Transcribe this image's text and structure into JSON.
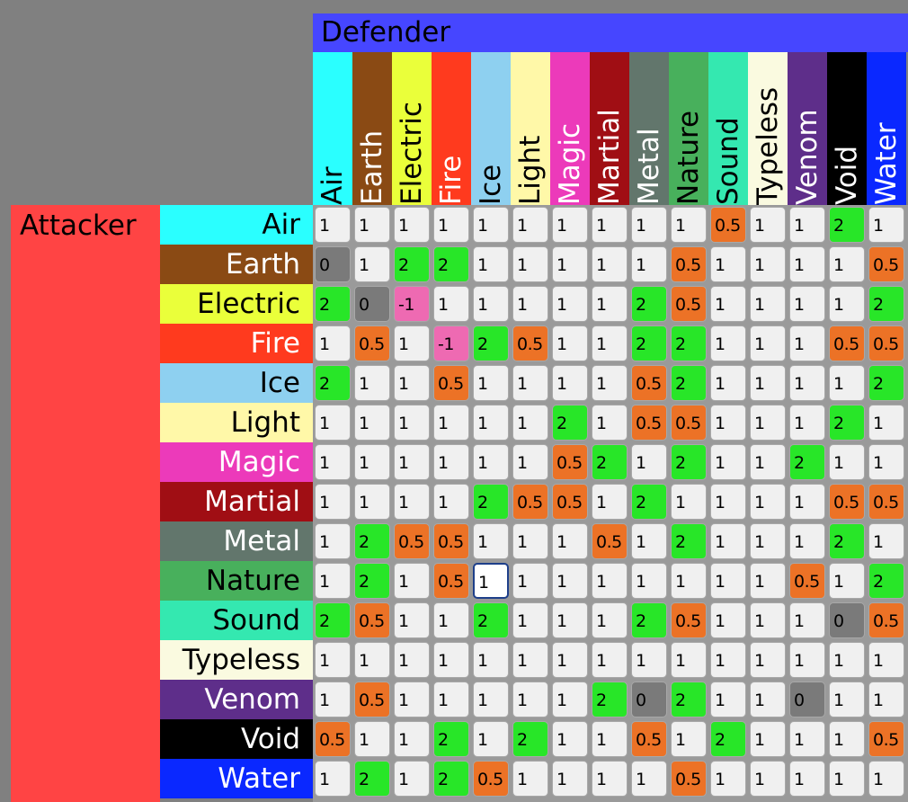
{
  "defender_label": "Defender",
  "attacker_label": "Attacker",
  "types": [
    {
      "name": "Air",
      "bg": "#2affff",
      "fg": "#000000"
    },
    {
      "name": "Earth",
      "bg": "#8a4a14",
      "fg": "#ffffff"
    },
    {
      "name": "Electric",
      "bg": "#eaff3a",
      "fg": "#000000"
    },
    {
      "name": "Fire",
      "bg": "#ff3a1e",
      "fg": "#ffffff"
    },
    {
      "name": "Ice",
      "bg": "#8ed0f0",
      "fg": "#000000"
    },
    {
      "name": "Light",
      "bg": "#fff8a8",
      "fg": "#000000"
    },
    {
      "name": "Magic",
      "bg": "#ec3aba",
      "fg": "#ffffff"
    },
    {
      "name": "Martial",
      "bg": "#a00e14",
      "fg": "#ffffff"
    },
    {
      "name": "Metal",
      "bg": "#62766c",
      "fg": "#ffffff"
    },
    {
      "name": "Nature",
      "bg": "#48b05c",
      "fg": "#000000"
    },
    {
      "name": "Sound",
      "bg": "#34e8b0",
      "fg": "#000000"
    },
    {
      "name": "Typeless",
      "bg": "#fafae0",
      "fg": "#000000"
    },
    {
      "name": "Venom",
      "bg": "#5e2e8a",
      "fg": "#ffffff"
    },
    {
      "name": "Void",
      "bg": "#000000",
      "fg": "#ffffff"
    },
    {
      "name": "Water",
      "bg": "#0a28ff",
      "fg": "#ffffff"
    }
  ],
  "value_colors": {
    "1": "#f0f0f0",
    "2": "#28e628",
    "0.5": "#ec7226",
    "0": "#7a7a7a",
    "-1": "#ee6ab2"
  },
  "selected_cell": {
    "row": 9,
    "col": 4
  },
  "matrix": [
    [
      "1",
      "1",
      "1",
      "1",
      "1",
      "1",
      "1",
      "1",
      "1",
      "1",
      "0.5",
      "1",
      "1",
      "2",
      "1"
    ],
    [
      "0",
      "1",
      "2",
      "2",
      "1",
      "1",
      "1",
      "1",
      "1",
      "0.5",
      "1",
      "1",
      "1",
      "1",
      "0.5"
    ],
    [
      "2",
      "0",
      "-1",
      "1",
      "1",
      "1",
      "1",
      "1",
      "2",
      "0.5",
      "1",
      "1",
      "1",
      "1",
      "2"
    ],
    [
      "1",
      "0.5",
      "1",
      "-1",
      "2",
      "0.5",
      "1",
      "1",
      "2",
      "2",
      "1",
      "1",
      "1",
      "0.5",
      "0.5"
    ],
    [
      "2",
      "1",
      "1",
      "0.5",
      "1",
      "1",
      "1",
      "1",
      "0.5",
      "2",
      "1",
      "1",
      "1",
      "1",
      "2"
    ],
    [
      "1",
      "1",
      "1",
      "1",
      "1",
      "1",
      "2",
      "1",
      "0.5",
      "0.5",
      "1",
      "1",
      "1",
      "2",
      "1"
    ],
    [
      "1",
      "1",
      "1",
      "1",
      "1",
      "1",
      "0.5",
      "2",
      "1",
      "2",
      "1",
      "1",
      "2",
      "1",
      "1"
    ],
    [
      "1",
      "1",
      "1",
      "1",
      "2",
      "0.5",
      "0.5",
      "1",
      "2",
      "1",
      "1",
      "1",
      "1",
      "0.5",
      "0.5"
    ],
    [
      "1",
      "2",
      "0.5",
      "0.5",
      "1",
      "1",
      "1",
      "0.5",
      "1",
      "2",
      "1",
      "1",
      "1",
      "2",
      "1"
    ],
    [
      "1",
      "2",
      "1",
      "0.5",
      "1",
      "1",
      "1",
      "1",
      "1",
      "1",
      "1",
      "1",
      "0.5",
      "1",
      "2"
    ],
    [
      "2",
      "0.5",
      "1",
      "1",
      "2",
      "1",
      "1",
      "1",
      "2",
      "0.5",
      "1",
      "1",
      "1",
      "0",
      "0.5"
    ],
    [
      "1",
      "1",
      "1",
      "1",
      "1",
      "1",
      "1",
      "1",
      "1",
      "1",
      "1",
      "1",
      "1",
      "1",
      "1"
    ],
    [
      "1",
      "0.5",
      "1",
      "1",
      "1",
      "1",
      "1",
      "2",
      "0",
      "2",
      "1",
      "1",
      "0",
      "1",
      "1"
    ],
    [
      "0.5",
      "1",
      "1",
      "2",
      "1",
      "2",
      "1",
      "1",
      "0.5",
      "1",
      "2",
      "1",
      "1",
      "1",
      "0.5"
    ],
    [
      "1",
      "2",
      "1",
      "2",
      "0.5",
      "1",
      "1",
      "1",
      "1",
      "0.5",
      "1",
      "1",
      "1",
      "1",
      "1"
    ]
  ]
}
